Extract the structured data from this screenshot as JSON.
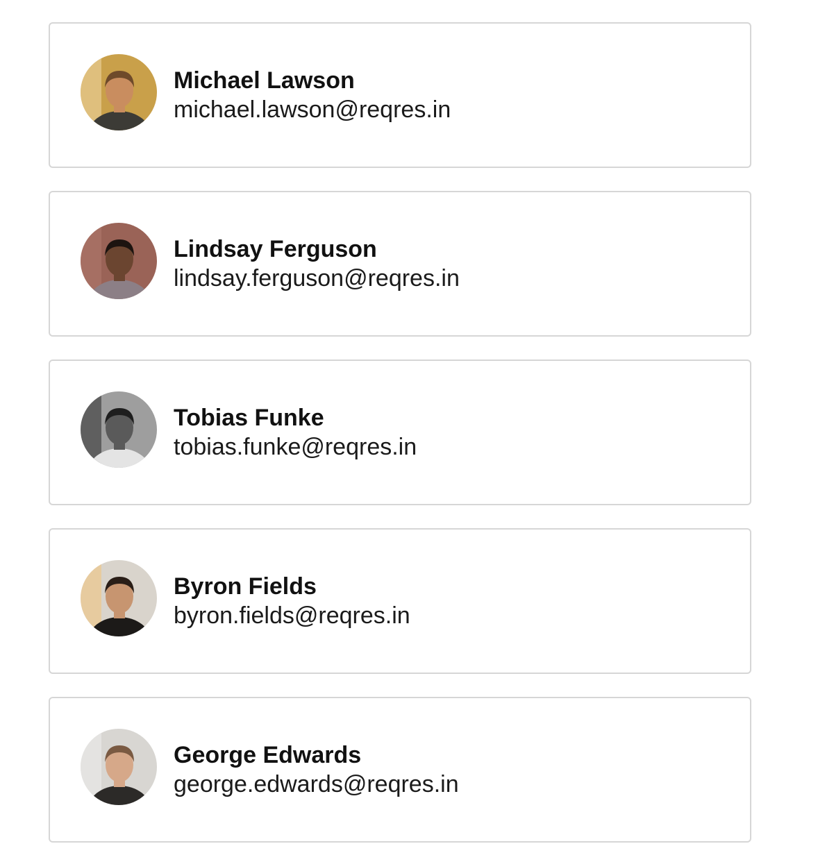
{
  "users": [
    {
      "name": "Michael Lawson",
      "email": "michael.lawson@reqres.in",
      "avatar": {
        "bg": "#c9a04a",
        "skin": "#c98d5f",
        "hair": "#6e4a2a",
        "shirt": "#3c3b36",
        "accent": "#f0d9a8"
      }
    },
    {
      "name": "Lindsay Ferguson",
      "email": "lindsay.ferguson@reqres.in",
      "avatar": {
        "bg": "#9a6357",
        "skin": "#6b4530",
        "hair": "#1d1410",
        "shirt": "#8c7f86",
        "accent": "#b07a6e"
      }
    },
    {
      "name": "Tobias Funke",
      "email": "tobias.funke@reqres.in",
      "avatar": {
        "bg": "#9e9e9e",
        "skin": "#5a5a5a",
        "hair": "#1e1e1e",
        "shirt": "#e4e4e4",
        "accent": "#2b2b2b"
      }
    },
    {
      "name": "Byron Fields",
      "email": "byron.fields@reqres.in",
      "avatar": {
        "bg": "#d9d4cc",
        "skin": "#c79570",
        "hair": "#2a1e17",
        "shirt": "#1c1a18",
        "accent": "#f2c27a"
      }
    },
    {
      "name": "George Edwards",
      "email": "george.edwards@reqres.in",
      "avatar": {
        "bg": "#d8d6d2",
        "skin": "#d6a889",
        "hair": "#7a5a42",
        "shirt": "#2c2a28",
        "accent": "#efefec"
      }
    }
  ]
}
